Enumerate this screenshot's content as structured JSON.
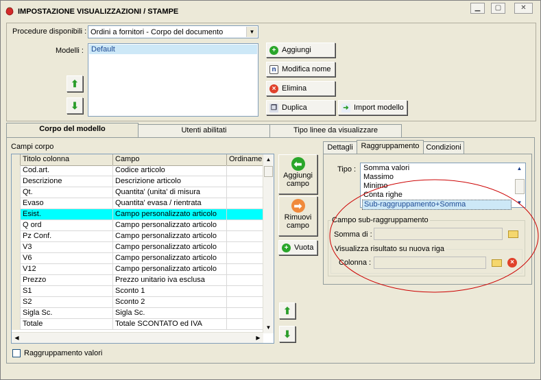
{
  "window": {
    "title": "IMPOSTAZIONE VISUALIZZAZIONI / STAMPE",
    "controls": [
      "minimize",
      "maximize",
      "close"
    ]
  },
  "top": {
    "procedure_label": "Procedure disponibili :",
    "procedure_value": "Ordini a fornitori - Corpo del documento",
    "modelli_label": "Modelli :",
    "modelli": [
      "Default"
    ],
    "buttons": {
      "aggiungi": "Aggiungi",
      "modifica_nome": "Modifica nome",
      "elimina": "Elimina",
      "duplica": "Duplica",
      "import_modello": "Import modello"
    }
  },
  "tabs": [
    "Corpo del modello",
    "Utenti abilitati",
    "Tipo linee da visualizzare"
  ],
  "active_tab": "Corpo del modello",
  "corpo": {
    "campi_label": "Campi corpo",
    "columns": [
      "Titolo colonna",
      "Campo",
      "Ordinamen"
    ],
    "rows": [
      {
        "titolo": "Cod.art.",
        "campo": "Codice articolo",
        "ord": ""
      },
      {
        "titolo": "Descrizione",
        "campo": "Descrizione articolo",
        "ord": ""
      },
      {
        "titolo": "Qt.",
        "campo": "Quantita' (unita' di misura",
        "ord": ""
      },
      {
        "titolo": "Evaso",
        "campo": "Quantita' evasa / rientrata",
        "ord": ""
      },
      {
        "titolo": "Esist.",
        "campo": "Campo personalizzato articolo",
        "ord": "",
        "selected": true
      },
      {
        "titolo": "Q ord",
        "campo": "Campo personalizzato articolo",
        "ord": ""
      },
      {
        "titolo": "Pz Conf.",
        "campo": "Campo personalizzato articolo",
        "ord": ""
      },
      {
        "titolo": "V3",
        "campo": "Campo personalizzato articolo",
        "ord": ""
      },
      {
        "titolo": "V6",
        "campo": "Campo personalizzato articolo",
        "ord": ""
      },
      {
        "titolo": "V12",
        "campo": "Campo personalizzato articolo",
        "ord": ""
      },
      {
        "titolo": "Prezzo",
        "campo": "Prezzo unitario iva esclusa",
        "ord": ""
      },
      {
        "titolo": "S1",
        "campo": "Sconto 1",
        "ord": ""
      },
      {
        "titolo": "S2",
        "campo": "Sconto 2",
        "ord": ""
      },
      {
        "titolo": "Sigla Sc.",
        "campo": "Sigla Sc.",
        "ord": ""
      },
      {
        "titolo": "Totale",
        "campo": "Totale SCONTATO ed IVA",
        "ord": ""
      }
    ],
    "aggiungi_campo": "Aggiungi campo",
    "rimuovi_campo": "Rimuovi campo",
    "vuota": "Vuota",
    "raggruppamento_valori": "Raggruppamento valori"
  },
  "subtabs": [
    "Dettagli",
    "Raggruppamento",
    "Condizioni"
  ],
  "active_subtab": "Raggruppamento",
  "raggruppamento": {
    "tipo_label": "Tipo :",
    "tipo_options": [
      "Somma valori",
      "Massimo",
      "Minimo",
      "Conta righe",
      "Sub-raggruppamento+Somma"
    ],
    "tipo_selected": "Sub-raggruppamento+Somma",
    "group_title": "Campo sub-raggruppamento",
    "somma_label": "Somma di :",
    "somma_value": "",
    "nuova_riga_title": "Visualizza risultato su nuova riga",
    "colonna_label": "Colonna :",
    "colonna_value": ""
  },
  "colors": {
    "selected_row": "#00ffff",
    "annotation_ellipse": "#cc0000",
    "list_selection": "#cde8f7"
  }
}
